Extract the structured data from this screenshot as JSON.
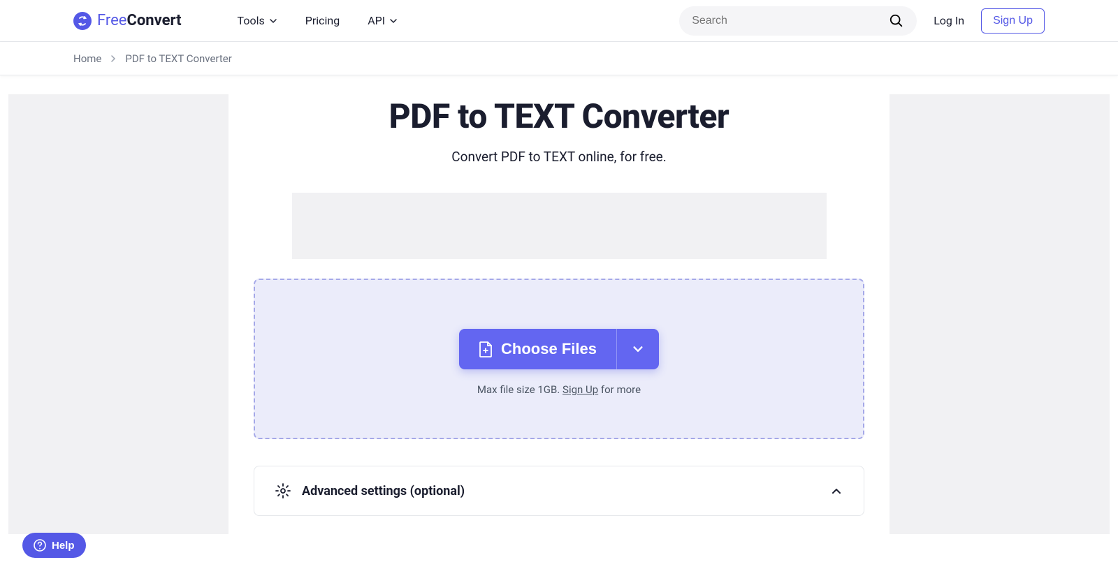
{
  "header": {
    "logo": {
      "text_light": "Free",
      "text_bold": "Convert"
    },
    "nav": {
      "tools": "Tools",
      "pricing": "Pricing",
      "api": "API"
    },
    "search_placeholder": "Search",
    "login": "Log In",
    "signup": "Sign Up"
  },
  "breadcrumb": {
    "home": "Home",
    "current": "PDF to TEXT Converter"
  },
  "main": {
    "title": "PDF to TEXT Converter",
    "subtitle": "Convert PDF to TEXT online, for free.",
    "choose_files": "Choose Files",
    "max_prefix": "Max file size 1GB. ",
    "signup_link": "Sign Up",
    "max_suffix": " for more",
    "advanced": "Advanced settings (optional)"
  },
  "help": "Help"
}
